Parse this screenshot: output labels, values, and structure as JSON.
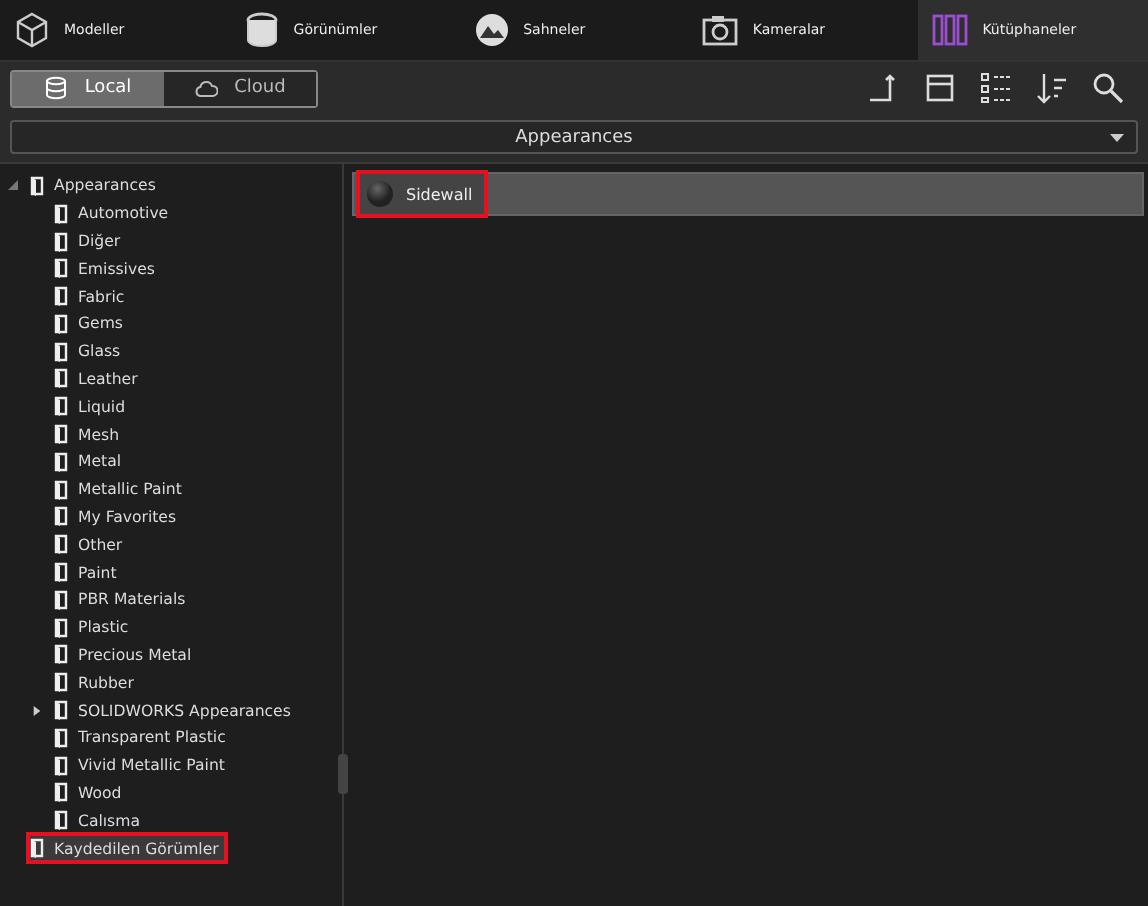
{
  "tabs": [
    {
      "label": "Modeller",
      "selected": false
    },
    {
      "label": "Görünümler",
      "selected": false
    },
    {
      "label": "Sahneler",
      "selected": false
    },
    {
      "label": "Kameralar",
      "selected": false
    },
    {
      "label": "Kütüphaneler",
      "selected": true
    }
  ],
  "source_toggle": [
    {
      "label": "Local",
      "selected": true
    },
    {
      "label": "Cloud",
      "selected": false
    }
  ],
  "dropdown": {
    "value": "Appearances"
  },
  "tree": [
    {
      "label": "Appearances",
      "kind": "group",
      "expanded": true,
      "selected": false,
      "highlighted": false,
      "children": [
        {
          "label": "Automotive",
          "kind": "folder",
          "selected": false,
          "highlighted": false
        },
        {
          "label": "Diğer",
          "kind": "folder",
          "selected": false,
          "highlighted": false
        },
        {
          "label": "Emissives",
          "kind": "folder",
          "selected": false,
          "highlighted": false
        },
        {
          "label": "Fabric",
          "kind": "folder",
          "selected": false,
          "highlighted": false
        },
        {
          "label": "Gems",
          "kind": "folder",
          "selected": false,
          "highlighted": false
        },
        {
          "label": "Glass",
          "kind": "folder",
          "selected": false,
          "highlighted": false
        },
        {
          "label": "Leather",
          "kind": "folder",
          "selected": false,
          "highlighted": false
        },
        {
          "label": "Liquid",
          "kind": "folder",
          "selected": false,
          "highlighted": false
        },
        {
          "label": "Mesh",
          "kind": "folder",
          "selected": false,
          "highlighted": false
        },
        {
          "label": "Metal",
          "kind": "folder",
          "selected": false,
          "highlighted": false
        },
        {
          "label": "Metallic Paint",
          "kind": "folder",
          "selected": false,
          "highlighted": false
        },
        {
          "label": "My Favorites",
          "kind": "folder",
          "selected": false,
          "highlighted": false
        },
        {
          "label": "Other",
          "kind": "folder",
          "selected": false,
          "highlighted": false
        },
        {
          "label": "Paint",
          "kind": "folder",
          "selected": false,
          "highlighted": false
        },
        {
          "label": "PBR Materials",
          "kind": "folder",
          "selected": false,
          "highlighted": false
        },
        {
          "label": "Plastic",
          "kind": "folder",
          "selected": false,
          "highlighted": false
        },
        {
          "label": "Precious Metal",
          "kind": "folder",
          "selected": false,
          "highlighted": false
        },
        {
          "label": "Rubber",
          "kind": "folder",
          "selected": false,
          "highlighted": false
        },
        {
          "label": "SOLIDWORKS Appearances",
          "kind": "group",
          "expanded": false,
          "selected": false,
          "highlighted": false
        },
        {
          "label": "Transparent Plastic",
          "kind": "folder",
          "selected": false,
          "highlighted": false
        },
        {
          "label": "Vivid Metallic Paint",
          "kind": "folder",
          "selected": false,
          "highlighted": false
        },
        {
          "label": "Wood",
          "kind": "folder",
          "selected": false,
          "highlighted": false
        },
        {
          "label": "Calısma",
          "kind": "folder",
          "selected": false,
          "highlighted": false
        }
      ]
    },
    {
      "label": "Kaydedilen Görümler",
      "kind": "folder",
      "selected": true,
      "highlighted": true
    }
  ],
  "items": [
    {
      "label": "Sidewall",
      "highlighted": true
    }
  ]
}
